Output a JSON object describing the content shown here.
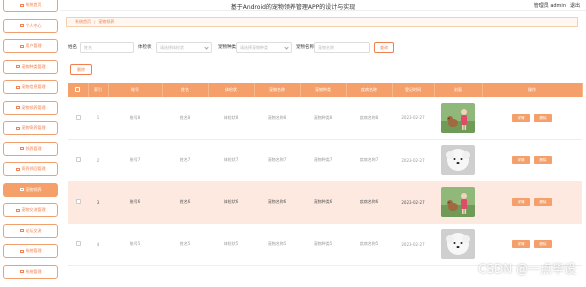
{
  "header": {
    "title": "基于Android的宠物领养管理APP的设计与实现",
    "user": "管理员 admin",
    "logout": "退出"
  },
  "sidebar": {
    "items": [
      {
        "label": "系统首页",
        "active": false
      },
      {
        "label": "个人中心",
        "active": false
      },
      {
        "label": "用户管理",
        "active": false
      },
      {
        "label": "宠物种类管理",
        "active": false
      },
      {
        "label": "宠物信息管理",
        "active": false
      },
      {
        "label": "宠物领养管理",
        "active": false
      },
      {
        "label": "宠物寄养管理",
        "active": false
      },
      {
        "label": "领养管理",
        "active": false
      },
      {
        "label": "寄养领回管理",
        "active": false
      },
      {
        "label": "宠物领养",
        "active": true
      },
      {
        "label": "宠物交流管理",
        "active": false
      },
      {
        "label": "论坛交流",
        "active": false
      },
      {
        "label": "系统管理",
        "active": false
      },
      {
        "label": "系统管理",
        "active": false
      }
    ]
  },
  "breadcrumb": {
    "home": "系统首页",
    "sep": "/",
    "current": "宠物领养"
  },
  "filters": {
    "name_label": "姓名",
    "name_placeholder": "姓名",
    "number_label": "体检状",
    "number_placeholder": "请选择体检状",
    "pettype_label": "宠物种类",
    "pettype_placeholder": "请选择宠物种类",
    "petname_label": "宠物名称",
    "petname_placeholder": "宠物名称",
    "search": "查询"
  },
  "actions": {
    "delete": "删除"
  },
  "table": {
    "headers": [
      "",
      "索引",
      "账号",
      "姓名",
      "体检状",
      "宠物名称",
      "宠物种类",
      "疾病名称",
      "登记时间",
      "封面",
      "操作"
    ],
    "rows": [
      {
        "index": "1",
        "account": "账号8",
        "name": "姓名8",
        "check": "体检状8",
        "petname": "宠物名称8",
        "pettype": "宠物种类8",
        "disease": "疾病名称8",
        "date": "2023-02-27",
        "img": "kid",
        "highlight": false
      },
      {
        "index": "2",
        "account": "账号7",
        "name": "姓名7",
        "check": "体检状7",
        "petname": "宠物名称7",
        "pettype": "宠物种类7",
        "disease": "疾病名称7",
        "date": "2023-02-27",
        "img": "dog",
        "highlight": false
      },
      {
        "index": "3",
        "account": "账号6",
        "name": "姓名6",
        "check": "体检状6",
        "petname": "宠物名称6",
        "pettype": "宠物种类6",
        "disease": "疾病名称6",
        "date": "2023-02-27",
        "img": "kid",
        "highlight": true
      },
      {
        "index": "4",
        "account": "账号5",
        "name": "姓名5",
        "check": "体检状5",
        "petname": "宠物名称5",
        "pettype": "宠物种类5",
        "disease": "疾病名称5",
        "date": "2023-02-27",
        "img": "dog",
        "highlight": false
      }
    ],
    "detail_label": "详情",
    "delete_label": "删除"
  },
  "watermark": "CSDN @一点毕设"
}
